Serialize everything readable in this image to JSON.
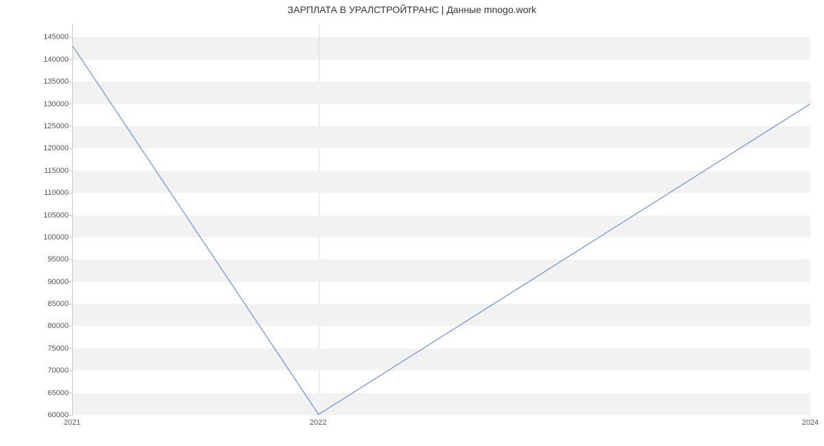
{
  "chart_data": {
    "type": "line",
    "title": "ЗАРПЛАТА В УРАЛСТРОЙТРАНС | Данные mnogo.work",
    "xlabel": "",
    "ylabel": "",
    "x": [
      2021,
      2022,
      2024
    ],
    "values": [
      143000,
      60000,
      130000
    ],
    "x_ticks": [
      2021,
      2022,
      2024
    ],
    "y_ticks": [
      60000,
      65000,
      70000,
      75000,
      80000,
      85000,
      90000,
      95000,
      100000,
      105000,
      110000,
      115000,
      120000,
      125000,
      130000,
      135000,
      140000,
      145000
    ],
    "ylim": [
      60000,
      148000
    ],
    "xlim": [
      2021,
      2024
    ],
    "line_color": "#6a8fd0"
  }
}
